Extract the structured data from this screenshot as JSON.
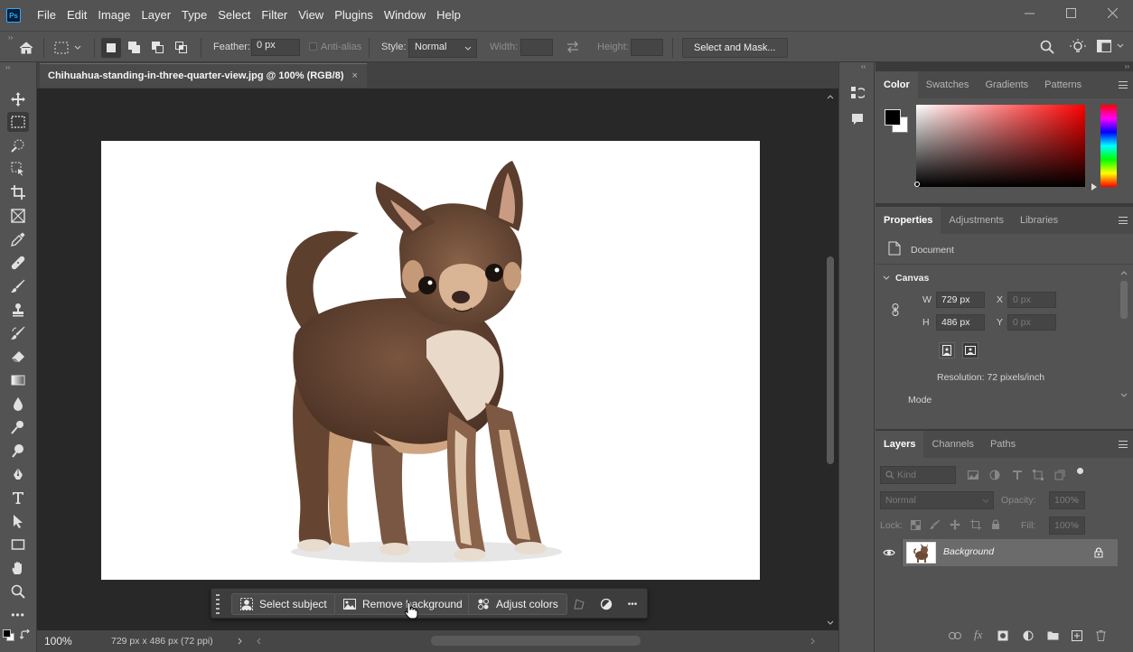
{
  "app": {
    "logo": "Ps"
  },
  "menu": [
    "File",
    "Edit",
    "Image",
    "Layer",
    "Type",
    "Select",
    "Filter",
    "View",
    "Plugins",
    "Window",
    "Help"
  ],
  "options": {
    "feather_label": "Feather:",
    "feather_value": "0 px",
    "antialias_label": "Anti-alias",
    "style_label": "Style:",
    "style_value": "Normal",
    "width_label": "Width:",
    "height_label": "Height:",
    "select_mask_label": "Select and Mask..."
  },
  "document": {
    "tab_title": "Chihuahua-standing-in-three-quarter-view.jpg @ 100% (RGB/8)",
    "close": "×"
  },
  "status": {
    "zoom": "100%",
    "doc_info": "729 px x 486 px (72 ppi)"
  },
  "context_bar": {
    "select_subject": "Select subject",
    "remove_background": "Remove background",
    "adjust_colors": "Adjust colors",
    "more": "•••"
  },
  "color_panel": {
    "tabs": [
      "Color",
      "Swatches",
      "Gradients",
      "Patterns"
    ]
  },
  "properties_panel": {
    "tabs": [
      "Properties",
      "Adjustments",
      "Libraries"
    ],
    "document_label": "Document",
    "canvas_header": "Canvas",
    "w_label": "W",
    "w_value": "729 px",
    "h_label": "H",
    "h_value": "486 px",
    "x_label": "X",
    "x_value": "0 px",
    "y_label": "Y",
    "y_value": "0 px",
    "resolution": "Resolution: 72 pixels/inch",
    "mode_label": "Mode"
  },
  "layers_panel": {
    "tabs": [
      "Layers",
      "Channels",
      "Paths"
    ],
    "kind_placeholder": "Kind",
    "blend_mode": "Normal",
    "opacity_label": "Opacity:",
    "opacity_value": "100%",
    "lock_label": "Lock:",
    "fill_label": "Fill:",
    "fill_value": "100%",
    "layer_name": "Background"
  },
  "colors": {
    "accent": "#31a8ff",
    "canvas_bg": "#282828",
    "panel_bg": "#535353"
  }
}
